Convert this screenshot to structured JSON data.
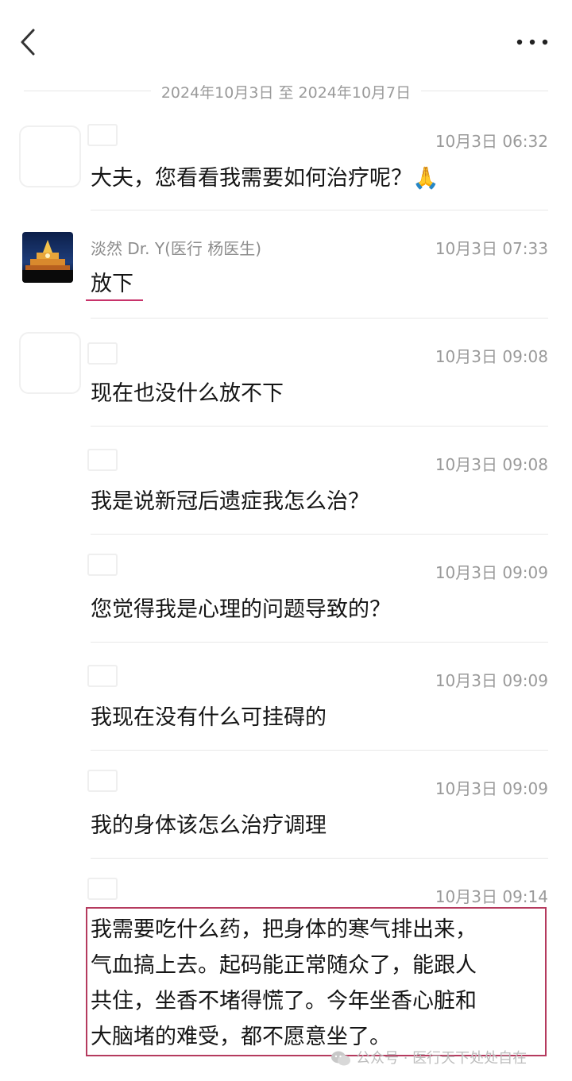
{
  "header": {
    "back_icon": "chevron-left-icon",
    "more_icon": "more-horizontal-icon"
  },
  "date_range": "2024年10月3日 至 2024年10月7日",
  "messages": [
    {
      "sender": "",
      "time": "10月3日 06:32",
      "text": "大夫，您看看我需要如何治疗呢？🙏"
    },
    {
      "sender": "淡然 Dr. Y(医行 杨医生)",
      "time": "10月3日 07:33",
      "text": "放下"
    },
    {
      "sender": "",
      "time": "10月3日 09:08",
      "text": "现在也没什么放不下"
    },
    {
      "sender": "",
      "time": "10月3日 09:08",
      "text": "我是说新冠后遗症我怎么治？"
    },
    {
      "sender": "",
      "time": "10月3日 09:09",
      "text": "您觉得我是心理的问题导致的？"
    },
    {
      "sender": "",
      "time": "10月3日 09:09",
      "text": "我现在没有什么可挂碍的"
    },
    {
      "sender": "",
      "time": "10月3日 09:09",
      "text": "我的身体该怎么治疗调理"
    },
    {
      "sender": "",
      "time": "10月3日 09:14",
      "lines": [
        "我需要吃什么药，把身体的寒气排出来，",
        "气血搞上去。起码能正常随众了，能跟人",
        "共住，坐香不堵得慌了。今年坐香心脏和",
        "大脑堵的难受，都不愿意坐了。"
      ]
    }
  ],
  "watermark": "公众号 · 医行天下处处自在",
  "colors": {
    "highlight": "#b53a5e",
    "underline": "#c8336a",
    "muted": "#9a9a9a"
  }
}
